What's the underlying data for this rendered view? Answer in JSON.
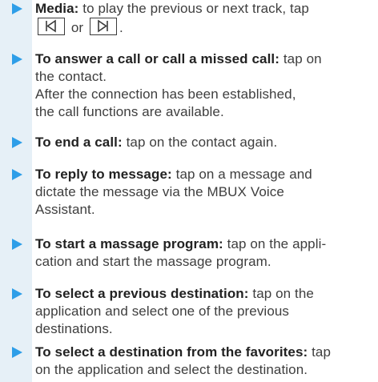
{
  "items": [
    {
      "lead": "Media:",
      "text_line1": " to play the previous or next track, tap",
      "button_prev_icon": "skip-previous-icon",
      "or_text": " or ",
      "button_next_icon": "skip-next-icon",
      "end_text": "."
    },
    {
      "lead": "To answer a call or call a missed call:",
      "text_line1": " tap on",
      "text_line2": "the contact.",
      "text_line3": "After the connection has been established,",
      "text_line4": "the call functions are available."
    },
    {
      "lead": "To end a call:",
      "text_line1": " tap on the contact again."
    },
    {
      "lead": "To reply to message:",
      "text_line1": " tap on a message and",
      "text_line2": "dictate the message via the MBUX Voice",
      "text_line3": "Assistant."
    },
    {
      "lead": "To start a massage program:",
      "text_line1": " tap on the appli-",
      "text_line2": "cation and start the massage program."
    },
    {
      "lead": "To select a previous destination:",
      "text_line1": " tap on the",
      "text_line2": "application and select one of the previous",
      "text_line3": "destinations."
    },
    {
      "lead": "To select a destination from the favorites:",
      "text_line1": " tap",
      "text_line2": "on the application and select the destination."
    }
  ],
  "colors": {
    "bullet_arrow": "#2e9ee8",
    "margin_strip": "#e6f0f7",
    "lead_text": "#222222",
    "body_text": "#3e3e3e"
  }
}
